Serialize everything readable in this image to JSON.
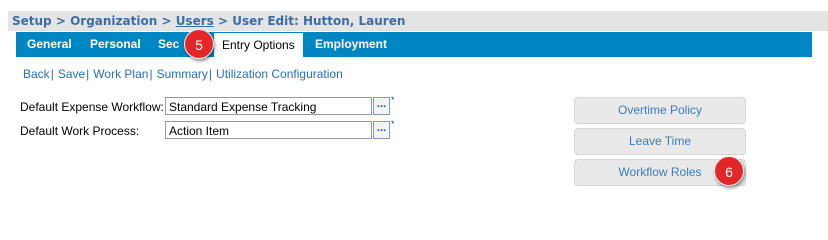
{
  "breadcrumb": {
    "setup": "Setup",
    "sep1": " > ",
    "organization": "Organization",
    "sep2": " > ",
    "users": "Users",
    "sep3": " > ",
    "current": "User Edit: Hutton, Lauren"
  },
  "tabs": {
    "general": "General",
    "personal": "Personal",
    "security": "Sec",
    "entry_options": "Entry Options",
    "employment": "Employment"
  },
  "subnav": {
    "back": "Back",
    "save": "Save",
    "work_plan": "Work Plan",
    "summary": "Summary",
    "utilization": "Utilization Configuration",
    "separator": "|"
  },
  "form": {
    "expense_workflow_label": "Default Expense Workflow:",
    "expense_workflow_value": "Standard Expense Tracking",
    "work_process_label": "Default Work Process:",
    "work_process_value": "Action Item",
    "lookup_label": "...",
    "required_mark": "*"
  },
  "side_buttons": {
    "overtime": "Overtime Policy",
    "leave": "Leave Time",
    "workflow_roles": "Workflow Roles"
  },
  "badges": {
    "step5": "5",
    "step6": "6"
  },
  "colors": {
    "tabbar": "#0086c3",
    "link": "#2a6fb5",
    "badge": "#e3262a"
  }
}
